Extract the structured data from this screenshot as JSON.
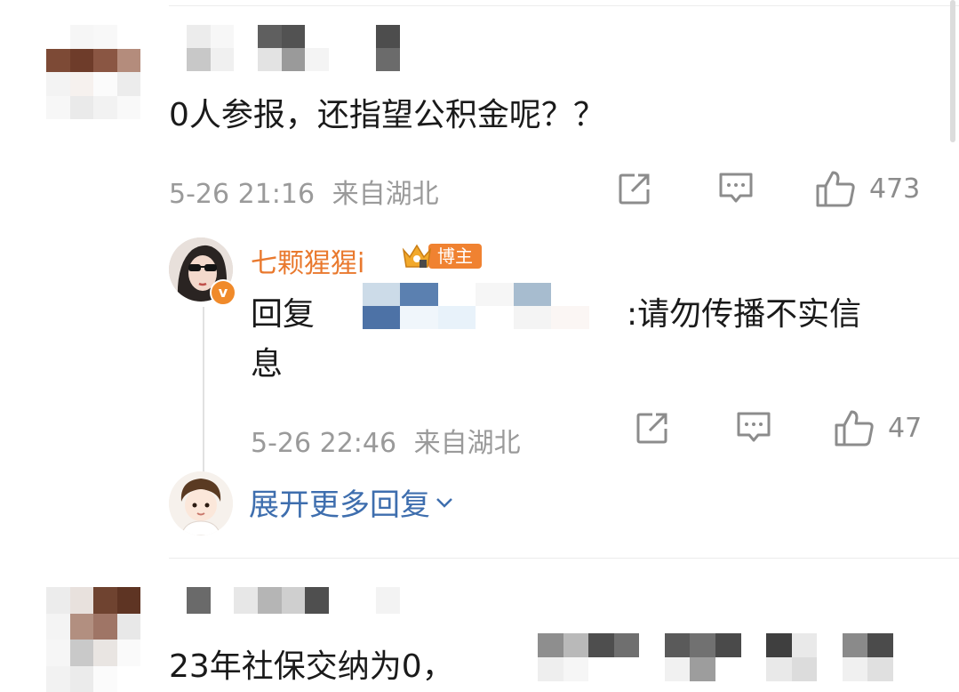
{
  "comments": [
    {
      "text": "0人参报，还指望公积金呢？？",
      "date": "5-26 21:16",
      "location": "来自湖北",
      "likes": "473",
      "reply": {
        "username": "七颗猩猩i",
        "badge": "博主",
        "verified_mark": "v",
        "prefix": "回复",
        "suffix": ":请勿传播不实信",
        "second_line": "息",
        "date": "5-26 22:46",
        "location": "来自湖北",
        "likes": "47"
      },
      "expand_label": "展开更多回复",
      "expand_icon": "chevron-down-icon"
    },
    {
      "text": "23年社保交纳为0，"
    }
  ],
  "icons": {
    "share": "share-icon",
    "comment": "comment-icon",
    "like": "thumbs-up-icon"
  },
  "colors": {
    "username": "#e9792e",
    "badge": "#f08231",
    "link": "#3e6eae",
    "meta": "#9a9a9a"
  }
}
